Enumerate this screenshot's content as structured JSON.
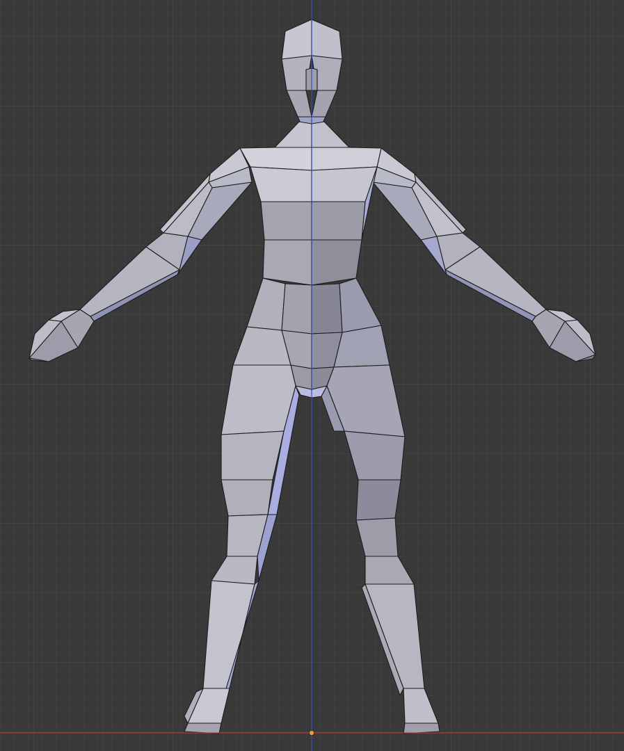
{
  "viewport": {
    "view": "front-orthographic",
    "object": "low-poly-humanoid-mesh",
    "display": "solid-wireframe",
    "colors": {
      "background": "#393939",
      "grid_minor": "#444444",
      "grid_major": "#4d4d4d",
      "axis_x": "#b03a3a",
      "axis_z": "#3b4bb4",
      "origin": "#f29b30",
      "mesh_light": "#d4d4de",
      "mesh_mid": "#b4b4c0",
      "mesh_dark": "#8a8a98",
      "mesh_blue": "#9ea3d6",
      "wire": "#1c1c1c"
    },
    "grid_visible": true,
    "origin_marker": true
  }
}
